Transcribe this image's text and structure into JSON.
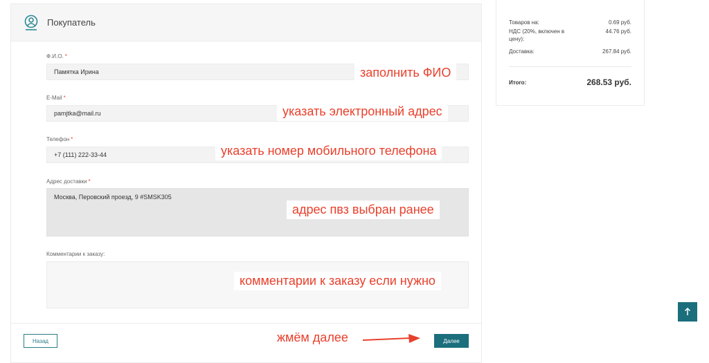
{
  "section": {
    "title": "Покупатель",
    "icon": "user-icon"
  },
  "fields": {
    "fio": {
      "label": "Ф.И.О.",
      "required_mark": "*",
      "value": "Памятка Ирина",
      "annotation": "заполнить ФИО"
    },
    "email": {
      "label": "E-Mail",
      "required_mark": "*",
      "value": "pamjtka@mail.ru",
      "annotation": "указать электронный адрес"
    },
    "phone": {
      "label": "Телефон",
      "required_mark": "*",
      "value": "+7 (111) 222-33-44",
      "annotation": "указать номер мобильного телефона"
    },
    "address": {
      "label": "Адрес доставки",
      "required_mark": "*",
      "value": "Москва, Перовский проезд, 9 #SMSK305",
      "annotation": "адрес пвз выбран ранее"
    },
    "comment": {
      "label": "Комментарии к заказу:",
      "value": "",
      "annotation": "комментарии к заказу если нужно"
    }
  },
  "footer": {
    "back_label": "Назад",
    "next_label": "Далее",
    "next_annotation": "жмём далее"
  },
  "summary": {
    "goods_label": "Товаров на:",
    "goods_value": "0.69 руб.",
    "vat_label": "НДС (20%, включен в цену):",
    "vat_value": "44.76 руб.",
    "delivery_label": "Доставка:",
    "delivery_value": "267.84 руб.",
    "total_label": "Итого:",
    "total_value": "268.53 руб."
  },
  "scroll_top_icon": "arrow-up-icon",
  "colors": {
    "accent": "#1b6e7c",
    "annotation": "#e8402c",
    "required": "#ee4444"
  }
}
